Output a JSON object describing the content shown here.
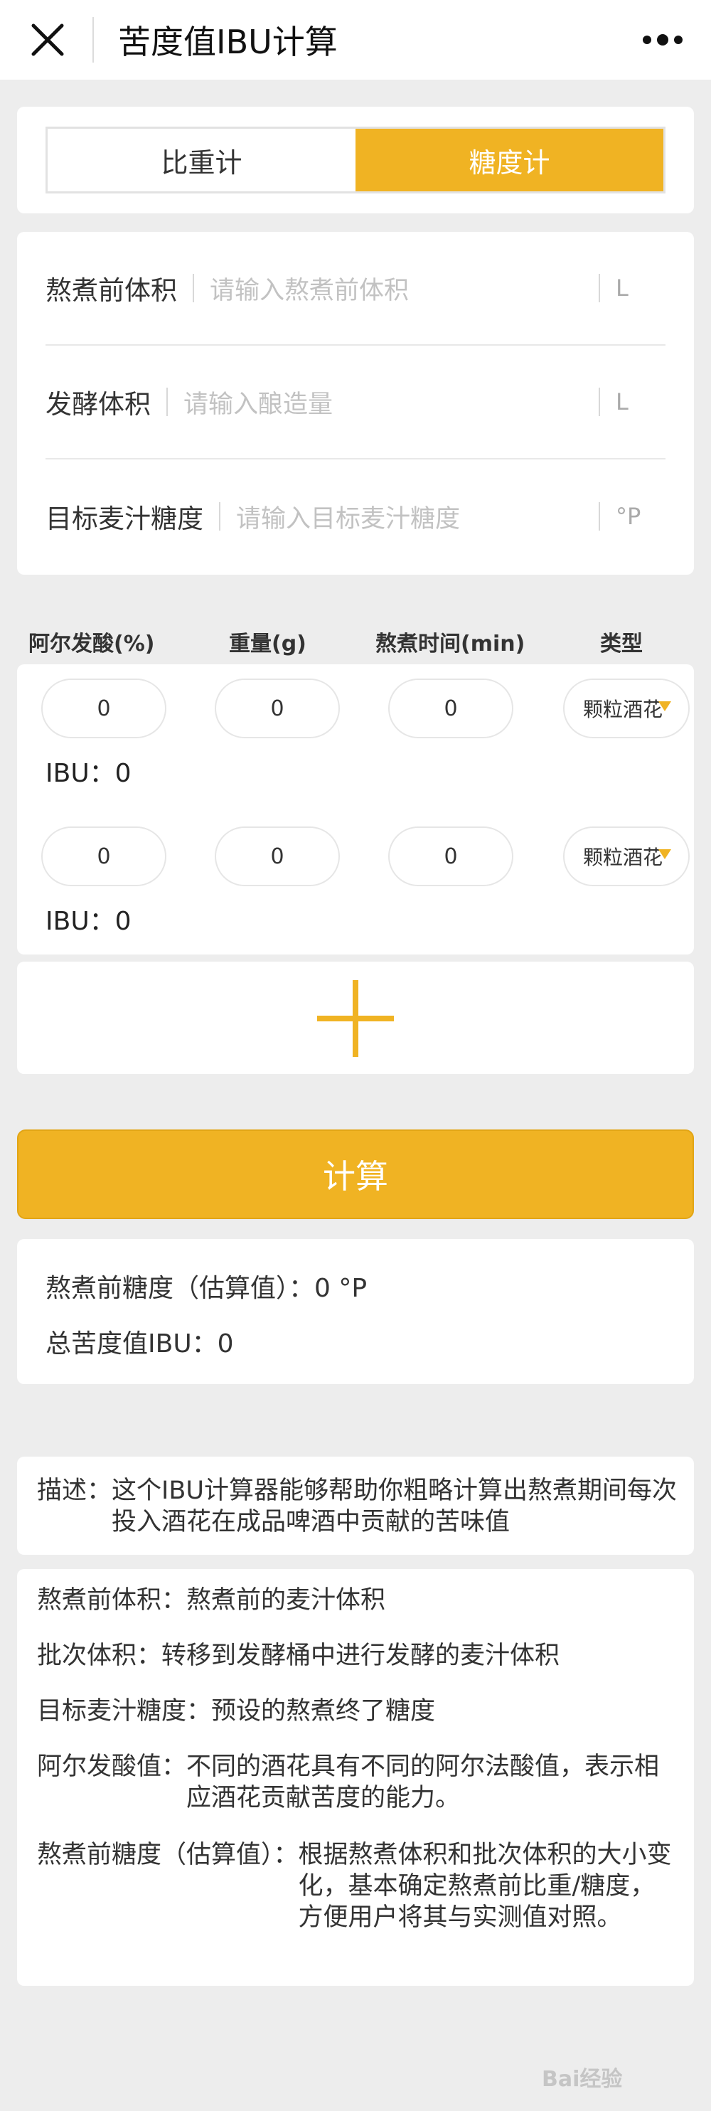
{
  "navbar": {
    "title": "苦度值IBU计算",
    "close_icon": "close-icon",
    "more_icon": "more-dots-icon"
  },
  "mode_toggle": {
    "options": [
      "比重计",
      "糖度计"
    ],
    "selected": "糖度计"
  },
  "inputs": [
    {
      "label": "熬煮前体积",
      "placeholder": "请输入熬煮前体积",
      "unit": "L"
    },
    {
      "label": "发酵体积",
      "placeholder": "请输入酿造量",
      "unit": "L"
    },
    {
      "label": "目标麦汁糖度",
      "placeholder": "请输入目标麦汁糖度",
      "unit": "°P"
    }
  ],
  "hop_table": {
    "headers": [
      "阿尔发酸(%)",
      "重量(g)",
      "熬煮时间(min)",
      "类型"
    ],
    "rows": [
      {
        "alpha": "0",
        "weight": "0",
        "time": "0",
        "type": "颗粒酒花",
        "ibu_label": "IBU：",
        "ibu": "0"
      },
      {
        "alpha": "0",
        "weight": "0",
        "time": "0",
        "type": "颗粒酒花",
        "ibu_label": "IBU：",
        "ibu": "0"
      }
    ],
    "add_icon": "plus-icon"
  },
  "calculate_label": "计算",
  "results": {
    "pre_boil_label": "熬煮前糖度（估算值）：",
    "pre_boil_value": "0 °P",
    "total_ibu_label": "总苦度值IBU：",
    "total_ibu_value": "0"
  },
  "description": {
    "label": "描述：",
    "text": "这个IBU计算器能够帮助你粗略计算出熬煮期间每次投入酒花在成品啤酒中贡献的苦味值"
  },
  "glossary": [
    {
      "term": "熬煮前体积：",
      "text": "熬煮前的麦汁体积"
    },
    {
      "term": "批次体积：",
      "text": "转移到发酵桶中进行发酵的麦汁体积"
    },
    {
      "term": "目标麦汁糖度：",
      "text": "预设的熬煮终了糖度"
    },
    {
      "term": "阿尔发酸值：",
      "text": "不同的酒花具有不同的阿尔法酸值，表示相应酒花贡献苦度的能力。"
    },
    {
      "term": "熬煮前糖度（估算值）：",
      "text": "根据熬煮体积和批次体积的大小变化，基本确定熬煮前比重/糖度，方便用户将其与实测值对照。"
    }
  ],
  "watermark": {
    "text": "Bai经验"
  },
  "colors": {
    "accent": "#f0b323",
    "background": "#ededed",
    "placeholder": "#c2c2c2"
  }
}
